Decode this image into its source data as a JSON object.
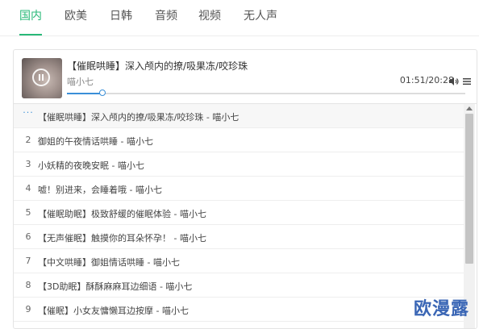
{
  "tabs": [
    {
      "label": "国内",
      "active": true
    },
    {
      "label": "欧美",
      "active": false
    },
    {
      "label": "日韩",
      "active": false
    },
    {
      "label": "音频",
      "active": false
    },
    {
      "label": "视频",
      "active": false
    },
    {
      "label": "无人声",
      "active": false
    }
  ],
  "player": {
    "title": "【催眠哄睡】深入颅内的撩/吸果冻/咬珍珠",
    "artist": "喵小七",
    "time": "01:51/20:28",
    "progress": 0.09,
    "accent_color": "#3a8fd8"
  },
  "playlist": [
    {
      "num": "···",
      "label": "【催眠哄睡】深入颅内的撩/吸果冻/咬珍珠 - 喵小七",
      "playing": true
    },
    {
      "num": "2",
      "label": "御姐的午夜情话哄睡 - 喵小七"
    },
    {
      "num": "3",
      "label": "小妖精的夜晚安眠 - 喵小七"
    },
    {
      "num": "4",
      "label": "嘘！别进来，会睡着哦 - 喵小七"
    },
    {
      "num": "5",
      "label": "【催眠助眠】极致舒缓的催眠体验 - 喵小七"
    },
    {
      "num": "6",
      "label": "【无声催眠】触摸你的耳朵怀孕！ - 喵小七"
    },
    {
      "num": "7",
      "label": "【中文哄睡】御姐情话哄睡 - 喵小七"
    },
    {
      "num": "8",
      "label": "【3D助眠】酥酥麻麻耳边细语 - 喵小七"
    },
    {
      "num": "9",
      "label": "【催眠】小女友慵懒耳边按摩 - 喵小七"
    }
  ],
  "watermark": "欧漫露",
  "brand_color": "#28b978"
}
